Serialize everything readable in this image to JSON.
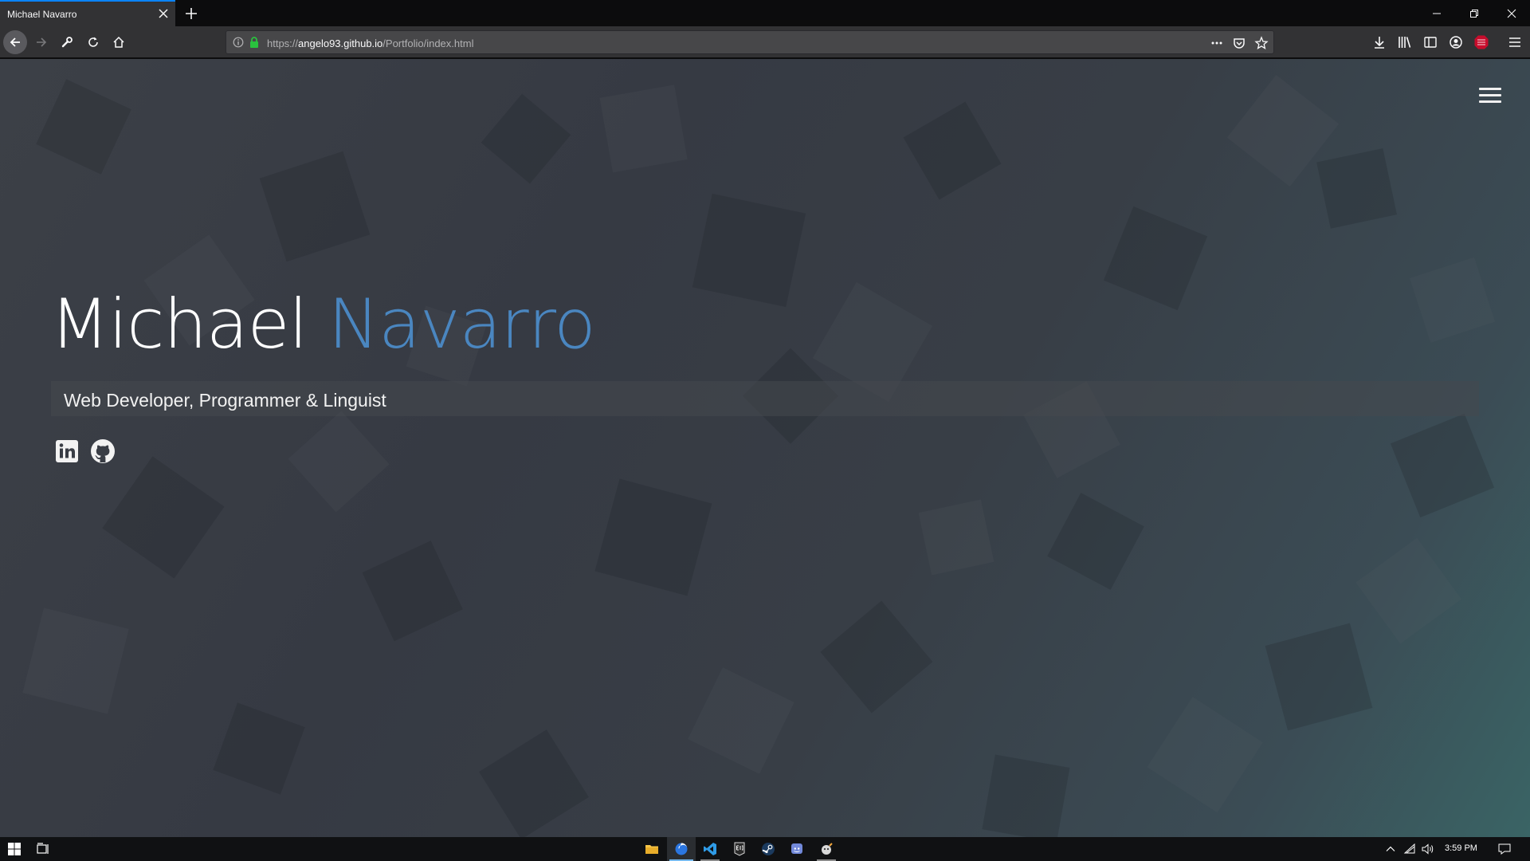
{
  "browser": {
    "tab_title": "Michael Navarro",
    "url_prefix": "https://",
    "url_host": "angelo93.github.io",
    "url_path": "/Portfolio/index.html"
  },
  "hero": {
    "first_name": "Michael",
    "last_name": "Navarro",
    "tagline": "Web Developer, Programmer & Linguist"
  },
  "social": [
    "linkedin-icon",
    "github-icon"
  ],
  "colors": {
    "accent_name": "#4a86c0",
    "browser_accent": "#0a84ff",
    "url_lock": "#2ac13e",
    "abp_badge": "#c70d2c"
  },
  "taskbar": {
    "clock": "3:59 PM",
    "apps": [
      "file-explorer-icon",
      "firefox-icon",
      "vscode-icon",
      "epic-games-icon",
      "steam-icon",
      "discord-icon",
      "git-app-icon"
    ]
  }
}
